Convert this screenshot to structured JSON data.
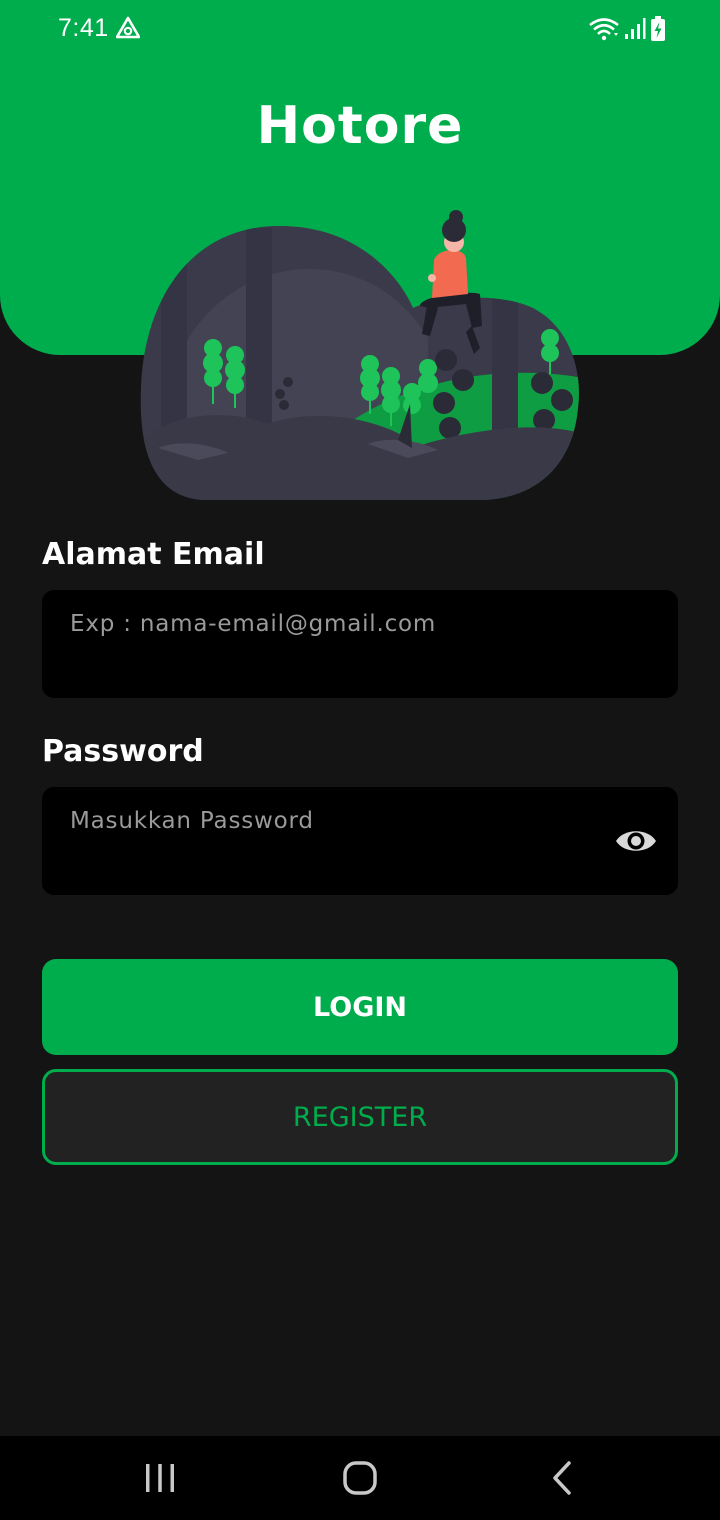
{
  "status_bar": {
    "time": "7:41",
    "app_icon": "triangle-app-icon",
    "indicators": [
      "wifi-icon",
      "signal-icon",
      "battery-charging-icon"
    ]
  },
  "header": {
    "title": "Hotore",
    "illustration": "woman-sitting-forest-illustration"
  },
  "form": {
    "email": {
      "label": "Alamat Email",
      "placeholder": "Exp : nama-email@gmail.com",
      "value": ""
    },
    "password": {
      "label": "Password",
      "placeholder": "Masukkan Password",
      "value": "",
      "toggle_icon": "eye-icon"
    }
  },
  "actions": {
    "login_label": "LOGIN",
    "register_label": "REGISTER"
  },
  "navigation": {
    "buttons": [
      "recent-apps-icon",
      "home-icon",
      "back-icon"
    ]
  },
  "colors": {
    "accent": "#00ad4c",
    "background": "#141414",
    "input_background": "#000000",
    "register_background": "#222222"
  }
}
